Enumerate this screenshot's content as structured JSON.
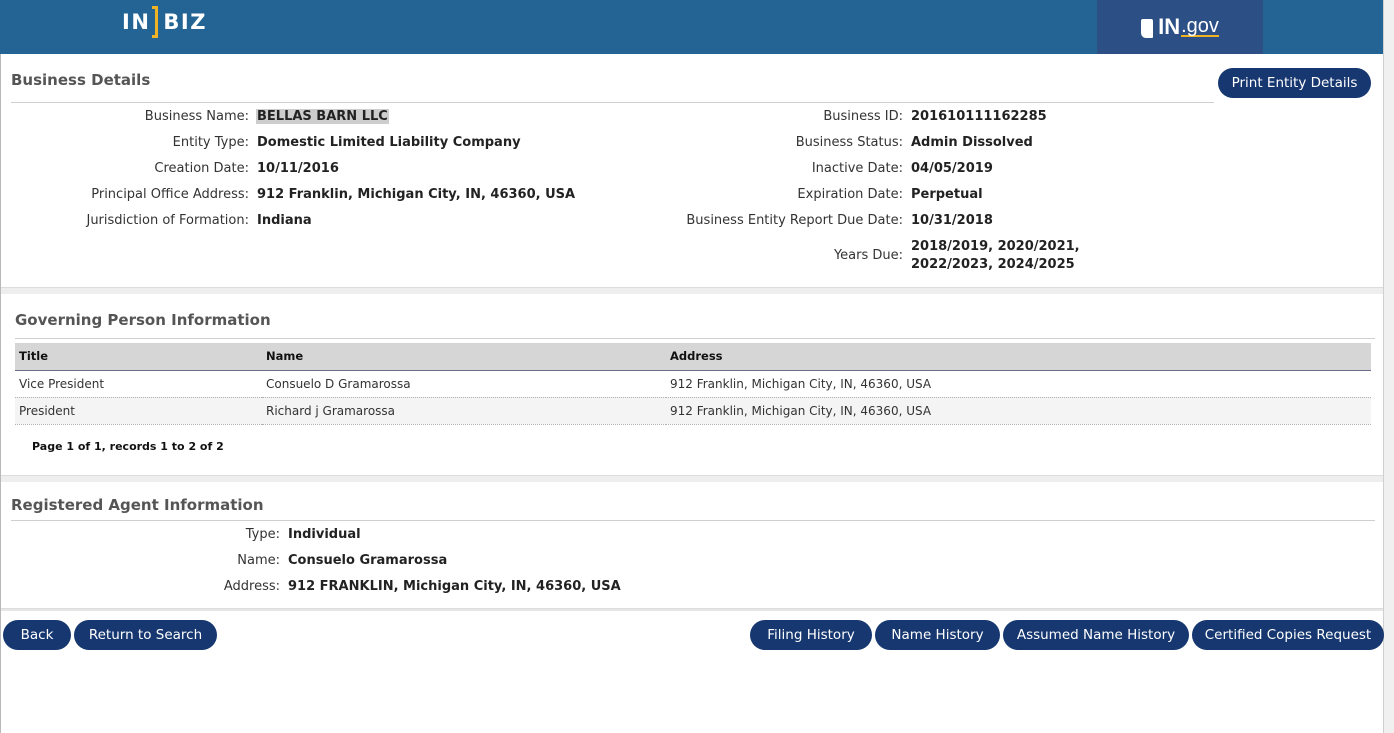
{
  "header": {
    "logo_left": "IN",
    "logo_right": "BIZ",
    "ingov_in": "IN",
    "ingov_gov": ".gov"
  },
  "business_details": {
    "title": "Business Details",
    "print_button": "Print Entity Details",
    "left": [
      {
        "label": "Business Name:",
        "value": "BELLAS BARN LLC"
      },
      {
        "label": "Entity Type:",
        "value": "Domestic Limited Liability Company"
      },
      {
        "label": "Creation Date:",
        "value": "10/11/2016"
      },
      {
        "label": "Principal Office Address:",
        "value": "912 Franklin, Michigan City, IN, 46360, USA"
      },
      {
        "label": "Jurisdiction of Formation:",
        "value": "Indiana"
      }
    ],
    "right": [
      {
        "label": "Business ID:",
        "value": "201610111162285"
      },
      {
        "label": "Business Status:",
        "value": "Admin Dissolved"
      },
      {
        "label": "Inactive Date:",
        "value": "04/05/2019"
      },
      {
        "label": "Expiration Date:",
        "value": "Perpetual"
      },
      {
        "label": "Business Entity Report Due Date:",
        "value": "10/31/2018"
      },
      {
        "label": "Years Due:",
        "value": "2018/2019, 2020/2021, 2022/2023, 2024/2025"
      }
    ]
  },
  "governing": {
    "title": "Governing Person Information",
    "columns": [
      "Title",
      "Name",
      "Address"
    ],
    "rows": [
      [
        "Vice President",
        "Consuelo D Gramarossa",
        "912 Franklin, Michigan City, IN, 46360, USA"
      ],
      [
        "President",
        "Richard j Gramarossa",
        "912 Franklin, Michigan City, IN, 46360, USA"
      ]
    ],
    "pager": "Page 1 of 1, records 1 to 2 of 2"
  },
  "agent": {
    "title": "Registered Agent Information",
    "fields": [
      {
        "label": "Type:",
        "value": "Individual"
      },
      {
        "label": "Name:",
        "value": "Consuelo Gramarossa"
      },
      {
        "label": "Address:",
        "value": "912 FRANKLIN, Michigan City, IN, 46360, USA"
      }
    ]
  },
  "actions": {
    "back": "Back",
    "return_to_search": "Return to Search",
    "filing_history": "Filing History",
    "name_history": "Name History",
    "assumed_name_history": "Assumed Name History",
    "certified_copies_request": "Certified Copies Request"
  },
  "colors": {
    "header_bg": "#236494",
    "ingov_bg": "#2c4f86",
    "button_bg": "#16376f",
    "accent": "#f0b323"
  }
}
